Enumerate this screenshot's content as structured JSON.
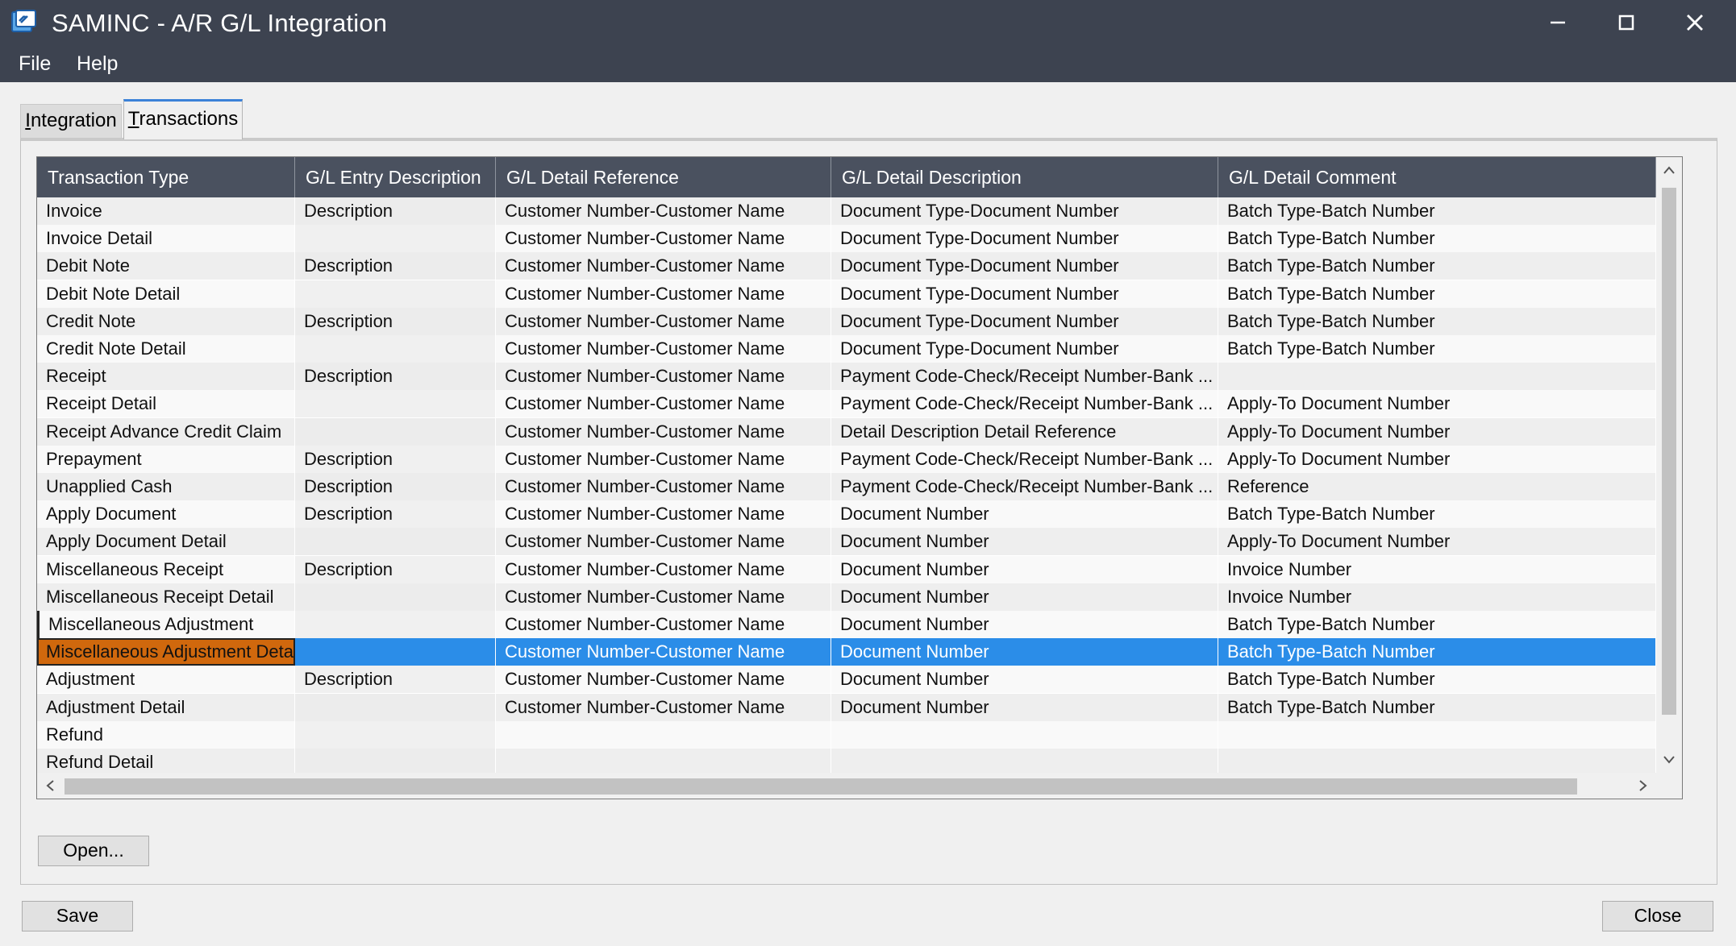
{
  "window": {
    "title": "SAMINC - A/R G/L Integration",
    "icon": "integration-app-icon",
    "controls": [
      "minimize-icon",
      "maximize-icon",
      "close-icon"
    ]
  },
  "menu": {
    "file": "File",
    "help": "Help"
  },
  "tabs": {
    "integration": "Integration",
    "transactions": "Transactions",
    "active": "Transactions"
  },
  "grid": {
    "columns": [
      "Transaction Type",
      "G/L Entry Description",
      "G/L Detail Reference",
      "G/L Detail Description",
      "G/L Detail Comment"
    ],
    "selected_row": 16,
    "rows": [
      [
        "Invoice",
        "Description",
        "Customer Number-Customer Name",
        "Document Type-Document Number",
        "Batch Type-Batch Number"
      ],
      [
        "Invoice Detail",
        "",
        "Customer Number-Customer Name",
        "Document Type-Document Number",
        "Batch Type-Batch Number"
      ],
      [
        "Debit Note",
        "Description",
        "Customer Number-Customer Name",
        "Document Type-Document Number",
        "Batch Type-Batch Number"
      ],
      [
        "Debit Note Detail",
        "",
        "Customer Number-Customer Name",
        "Document Type-Document Number",
        "Batch Type-Batch Number"
      ],
      [
        "Credit Note",
        "Description",
        "Customer Number-Customer Name",
        "Document Type-Document Number",
        "Batch Type-Batch Number"
      ],
      [
        "Credit Note Detail",
        "",
        "Customer Number-Customer Name",
        "Document Type-Document Number",
        "Batch Type-Batch Number"
      ],
      [
        "Receipt",
        "Description",
        "Customer Number-Customer Name",
        "Payment Code-Check/Receipt Number-Bank ...",
        ""
      ],
      [
        "Receipt Detail",
        "",
        "Customer Number-Customer Name",
        "Payment Code-Check/Receipt Number-Bank ...",
        "Apply-To Document Number"
      ],
      [
        "Receipt Advance Credit Claim",
        "",
        "Customer Number-Customer Name",
        "Detail Description Detail Reference",
        "Apply-To Document Number"
      ],
      [
        "Prepayment",
        "Description",
        "Customer Number-Customer Name",
        "Payment Code-Check/Receipt Number-Bank ...",
        "Apply-To Document Number"
      ],
      [
        "Unapplied Cash",
        "Description",
        "Customer Number-Customer Name",
        "Payment Code-Check/Receipt Number-Bank ...",
        "Reference"
      ],
      [
        "Apply Document",
        "Description",
        "Customer Number-Customer Name",
        "Document Number",
        "Batch Type-Batch Number"
      ],
      [
        "Apply Document Detail",
        "",
        "Customer Number-Customer Name",
        "Document Number",
        "Apply-To Document Number"
      ],
      [
        "Miscellaneous Receipt",
        "Description",
        "Customer Number-Customer Name",
        "Document Number",
        "Invoice Number"
      ],
      [
        "Miscellaneous Receipt Detail",
        "",
        "Customer Number-Customer Name",
        "Document Number",
        "Invoice Number"
      ],
      [
        "Miscellaneous Adjustment",
        "",
        "Customer Number-Customer Name",
        "Document Number",
        "Batch Type-Batch Number"
      ],
      [
        "Miscellaneous Adjustment Detail",
        "",
        "Customer Number-Customer Name",
        "Document Number",
        "Batch Type-Batch Number"
      ],
      [
        "Adjustment",
        "Description",
        "Customer Number-Customer Name",
        "Document Number",
        "Batch Type-Batch Number"
      ],
      [
        "Adjustment Detail",
        "",
        "Customer Number-Customer Name",
        "Document Number",
        "Batch Type-Batch Number"
      ],
      [
        "Refund",
        "",
        "",
        "",
        ""
      ],
      [
        "Refund Detail",
        "",
        "",
        "",
        ""
      ]
    ]
  },
  "buttons": {
    "open": "Open...",
    "save": "Save",
    "close": "Close"
  },
  "colors": {
    "titlebar": "#3d4350",
    "header": "#4a515f",
    "selection": "#2b8de8",
    "selected_cell": "#d0680d",
    "tab_accent": "#3c82d8"
  }
}
